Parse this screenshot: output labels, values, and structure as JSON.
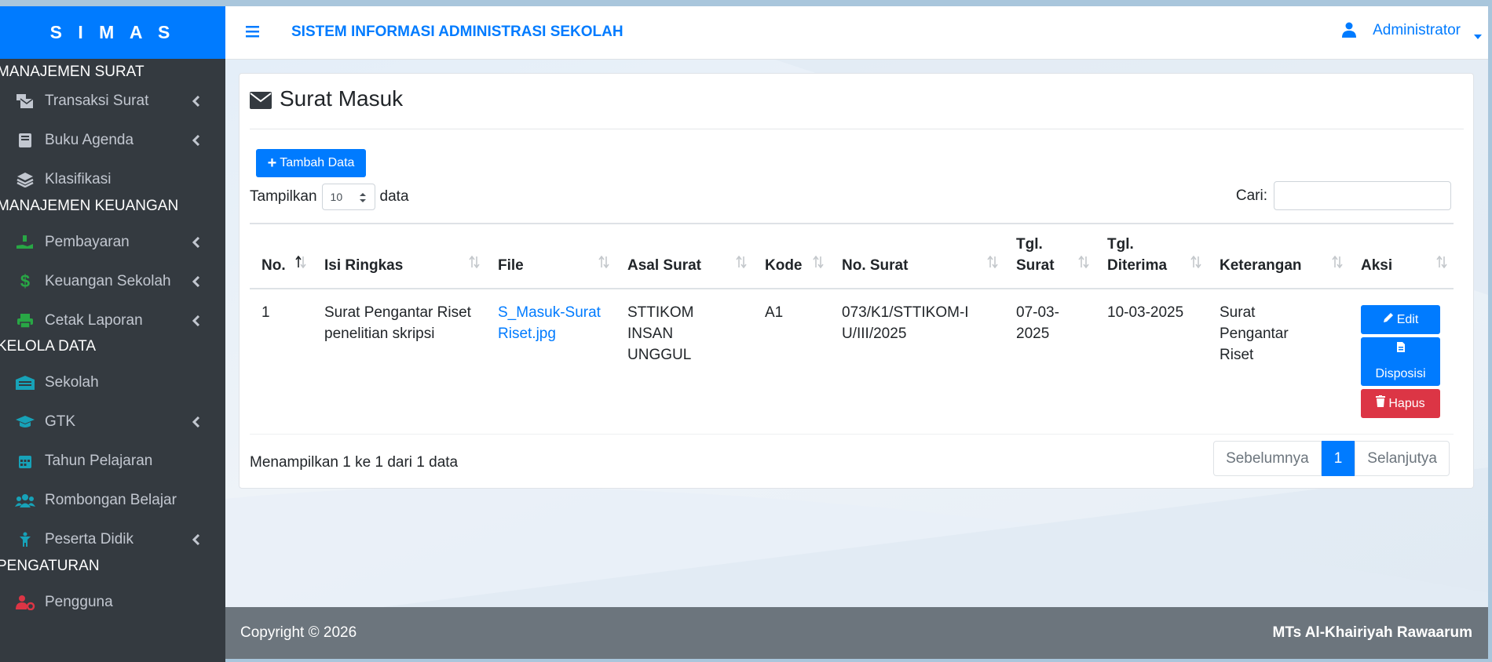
{
  "brand": "S I M A S",
  "app_title": "SISTEM INFORMASI ADMINISTRASI SEKOLAH",
  "user": {
    "name": "Administrator"
  },
  "sidebar": {
    "sections": [
      {
        "header": "MANAJEMEN SURAT",
        "items": [
          {
            "label": "Transaksi Surat",
            "icon": "mail-bulk-icon",
            "has_children": true
          },
          {
            "label": "Buku Agenda",
            "icon": "book-icon",
            "has_children": true
          },
          {
            "label": "Klasifikasi",
            "icon": "layers-icon",
            "has_children": false
          }
        ]
      },
      {
        "header": "MANAJEMEN KEUANGAN",
        "items": [
          {
            "label": "Pembayaran",
            "icon": "hand-money-icon",
            "has_children": true
          },
          {
            "label": "Keuangan Sekolah",
            "icon": "dollar-icon",
            "has_children": true
          },
          {
            "label": "Cetak Laporan",
            "icon": "printer-icon",
            "has_children": true
          }
        ]
      },
      {
        "header": "KELOLA DATA",
        "items": [
          {
            "label": "Sekolah",
            "icon": "school-icon",
            "has_children": false
          },
          {
            "label": "GTK",
            "icon": "graduation-cap-icon",
            "has_children": true
          },
          {
            "label": "Tahun Pelajaran",
            "icon": "calendar-icon",
            "has_children": false
          },
          {
            "label": "Rombongan Belajar",
            "icon": "users-icon",
            "has_children": false
          },
          {
            "label": "Peserta Didik",
            "icon": "child-icon",
            "has_children": true
          }
        ]
      },
      {
        "header": "PENGATURAN",
        "items": [
          {
            "label": "Pengguna",
            "icon": "user-cog-icon",
            "has_children": false
          }
        ]
      }
    ]
  },
  "page": {
    "title": "Surat Masuk",
    "add_button": "Tambah Data",
    "length": {
      "prefix": "Tampilkan",
      "value": "10",
      "suffix": "data"
    },
    "search_label": "Cari:",
    "info": "Menampilkan 1 ke 1 dari 1 data"
  },
  "table": {
    "headers": [
      "No.",
      "Isi Ringkas",
      "File",
      "Asal Surat",
      "Kode",
      "No. Surat",
      "Tgl. Surat",
      "Tgl. Diterima",
      "Keterangan",
      "Aksi"
    ],
    "rows": [
      {
        "no": "1",
        "isi": "Surat Pengantar Riset penelitian skripsi",
        "file": "S_Masuk-Surat Riset.jpg",
        "asal": "STTIKOM INSAN UNGGUL",
        "kode": "A1",
        "no_surat": "073/K1/STTIKOM-IU/III/2025",
        "tgl_surat": "07-03-2025",
        "tgl_diterima": "10-03-2025",
        "keterangan": "Surat Pengantar Riset",
        "actions": {
          "edit": "Edit",
          "disposisi": "Disposisi",
          "hapus": "Hapus"
        }
      }
    ]
  },
  "pagination": {
    "prev": "Sebelumnya",
    "current": "1",
    "next": "Selanjutya"
  },
  "footer": {
    "copyright": "Copyright © 2026",
    "school": "MTs Al-Khairiyah Rawaarum"
  },
  "colors": {
    "primary": "#007bff",
    "danger": "#dc3545",
    "sidebar": "#343a40",
    "footer": "#6c757d"
  }
}
